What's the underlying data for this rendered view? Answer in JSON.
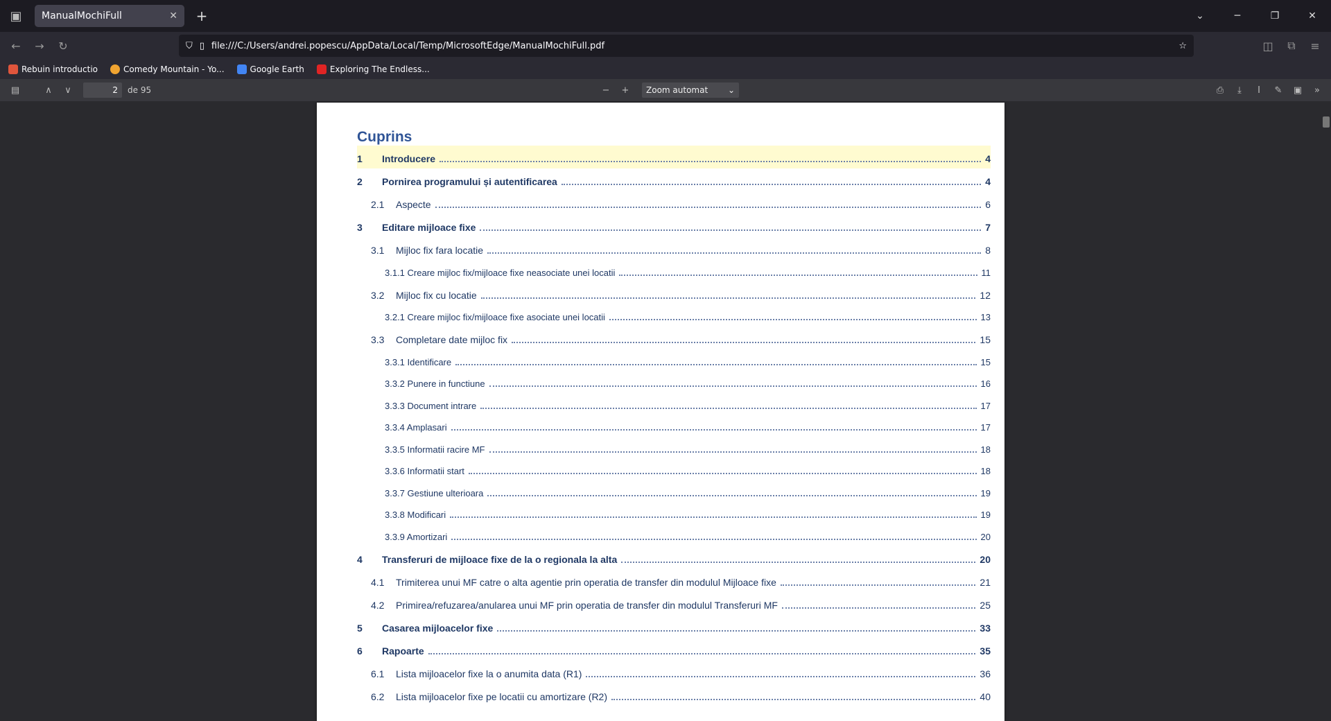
{
  "browser": {
    "tab_title": "ManualMochiFull",
    "url": "file:///C:/Users/andrei.popescu/AppData/Local/Temp/MicrosoftEdge/ManualMochiFull.pdf",
    "bookmarks": [
      {
        "label": "Rebuin introductio",
        "color": "#e0553c"
      },
      {
        "label": "Comedy Mountain - Yo...",
        "color": "#f0a431"
      },
      {
        "label": "Google Earth",
        "color": "#4285f4"
      },
      {
        "label": "Exploring The Endless...",
        "color": "#e02424"
      }
    ]
  },
  "pdf_toolbar": {
    "page_current": "2",
    "page_total": "de 95",
    "zoom": "Zoom automat"
  },
  "document": {
    "toc_title": "Cuprins",
    "entries": [
      {
        "num": "1",
        "text": "Introducere",
        "page": "4",
        "level": 1
      },
      {
        "num": "2",
        "text": "Pornirea programului și autentificarea",
        "page": "4",
        "level": 1
      },
      {
        "num": "2.1",
        "text": "Aspecte",
        "page": "6",
        "level": 2
      },
      {
        "num": "3",
        "text": "Editare mijloace fixe",
        "page": "7",
        "level": 1
      },
      {
        "num": "3.1",
        "text": "Mijloc fix fara locatie",
        "page": "8",
        "level": 2
      },
      {
        "num": "",
        "text": "3.1.1 Creare mijloc fix/mijloace fixe neasociate unei locatii",
        "page": "11",
        "level": 3
      },
      {
        "num": "3.2",
        "text": "Mijloc fix cu locatie",
        "page": "12",
        "level": 2
      },
      {
        "num": "",
        "text": "3.2.1 Creare mijloc fix/mijloace fixe asociate unei locatii",
        "page": "13",
        "level": 3
      },
      {
        "num": "3.3",
        "text": "Completare date mijloc fix",
        "page": "15",
        "level": 2
      },
      {
        "num": "",
        "text": "3.3.1 Identificare",
        "page": "15",
        "level": 3
      },
      {
        "num": "",
        "text": "3.3.2 Punere in functiune",
        "page": "16",
        "level": 3
      },
      {
        "num": "",
        "text": "3.3.3 Document intrare",
        "page": "17",
        "level": 3
      },
      {
        "num": "",
        "text": "3.3.4 Amplasari",
        "page": "17",
        "level": 3
      },
      {
        "num": "",
        "text": "3.3.5 Informatii racire MF",
        "page": "18",
        "level": 3
      },
      {
        "num": "",
        "text": "3.3.6 Informatii start",
        "page": "18",
        "level": 3
      },
      {
        "num": "",
        "text": "3.3.7 Gestiune ulterioara",
        "page": "19",
        "level": 3
      },
      {
        "num": "",
        "text": "3.3.8 Modificari",
        "page": "19",
        "level": 3
      },
      {
        "num": "",
        "text": "3.3.9 Amortizari",
        "page": "20",
        "level": 3
      },
      {
        "num": "4",
        "text": "Transferuri de mijloace fixe de la o regionala la alta",
        "page": "20",
        "level": 1
      },
      {
        "num": "4.1",
        "text": "Trimiterea unui MF catre o alta agentie prin operatia de transfer din modulul Mijloace fixe",
        "page": "21",
        "level": 2
      },
      {
        "num": "4.2",
        "text": "Primirea/refuzarea/anularea unui MF prin operatia de transfer din modulul Transferuri MF",
        "page": "25",
        "level": 2
      },
      {
        "num": "5",
        "text": "Casarea mijloacelor fixe",
        "page": "33",
        "level": 1
      },
      {
        "num": "6",
        "text": "Rapoarte",
        "page": "35",
        "level": 1
      },
      {
        "num": "6.1",
        "text": "Lista mijloacelor fixe la o anumita data (R1)",
        "page": "36",
        "level": 2
      },
      {
        "num": "6.2",
        "text": "Lista mijloacelor fixe pe locatii cu amortizare (R2)",
        "page": "40",
        "level": 2
      }
    ]
  }
}
